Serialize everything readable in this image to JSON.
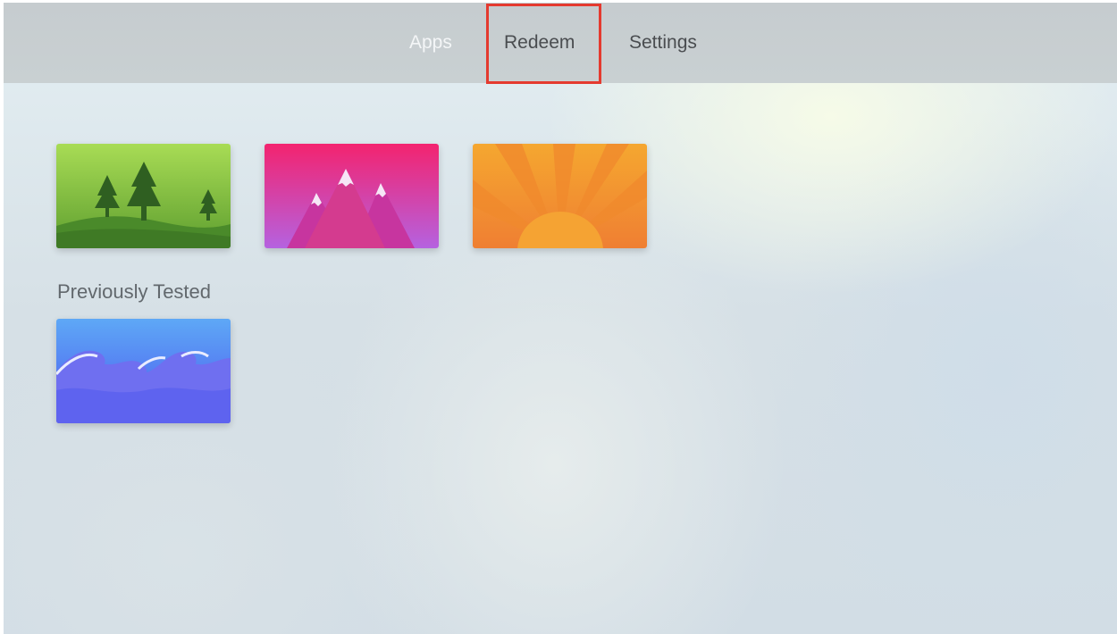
{
  "nav": {
    "tabs": [
      {
        "label": "Apps"
      },
      {
        "label": "Redeem"
      },
      {
        "label": "Settings"
      }
    ],
    "highlighted_tab": "Redeem",
    "highlight_color": "#e43a2f"
  },
  "apps": {
    "tiles": [
      {
        "icon": "forest-icon",
        "colors": [
          "#9bd24a",
          "#4f8f2c"
        ]
      },
      {
        "icon": "mountain-icon",
        "colors": [
          "#f3236f",
          "#b05ce0"
        ]
      },
      {
        "icon": "sunburst-icon",
        "colors": [
          "#f5a530",
          "#ef7f32"
        ]
      }
    ]
  },
  "previously_tested": {
    "title": "Previously Tested",
    "tiles": [
      {
        "icon": "waves-icon",
        "colors": [
          "#5da5f5",
          "#4d5cf0"
        ]
      }
    ]
  }
}
